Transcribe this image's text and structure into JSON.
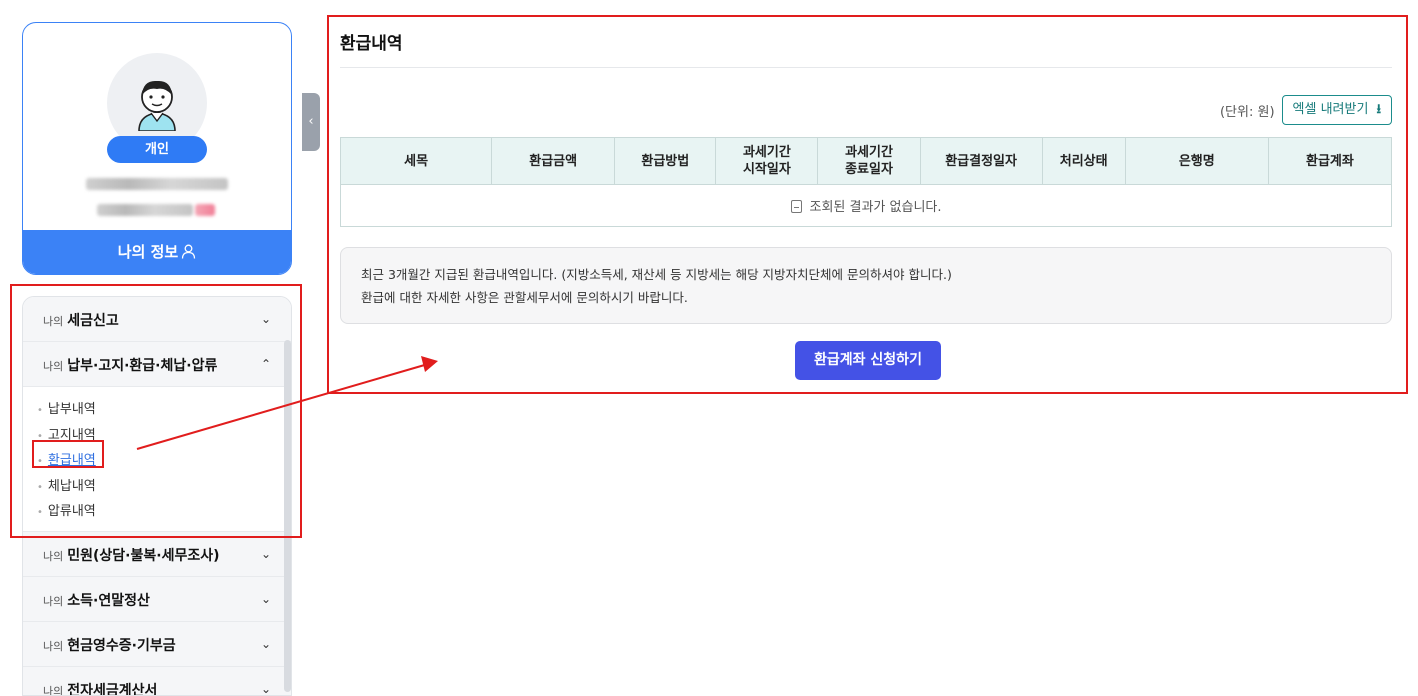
{
  "profile": {
    "type_badge": "개인",
    "my_info_label": "나의 정보"
  },
  "side_menu": {
    "prefix": "나의",
    "sections": [
      {
        "title": "세금신고",
        "expanded": false
      },
      {
        "title": "납부·고지·환급·체납·압류",
        "expanded": true,
        "items": [
          "납부내역",
          "고지내역",
          "환급내역",
          "체납내역",
          "압류내역"
        ],
        "active_item": "환급내역"
      },
      {
        "title": "민원(상담·불복·세무조사)",
        "expanded": false
      },
      {
        "title": "소득·연말정산",
        "expanded": false
      },
      {
        "title": "현금영수증·기부금",
        "expanded": false
      },
      {
        "title": "전자세금계산서",
        "expanded": false
      }
    ]
  },
  "main": {
    "title": "환급내역",
    "unit_text": "(단위: 원)",
    "excel_button": "엑셀 내려받기",
    "table": {
      "headers": [
        "세목",
        "환급금액",
        "환급방법",
        "과세기간\n시작일자",
        "과세기간\n종료일자",
        "환급결정일자",
        "처리상태",
        "은행명",
        "환급계좌"
      ],
      "empty_message": "조회된 결과가 없습니다."
    },
    "notice_lines": [
      "최근 3개월간 지급된 환급내역입니다. (지방소득세, 재산세 등 지방세는 해당 지방자치단체에 문의하셔야 합니다.)",
      "환급에 대한 자세한 사항은 관할세무서에 문의하시기 바랍니다."
    ],
    "apply_button": "환급계좌 신청하기"
  },
  "icons": {
    "chevron_down": "chevron-down-icon",
    "chevron_up": "chevron-up-icon",
    "download": "download-icon",
    "user": "user-icon",
    "document": "document-icon"
  },
  "colors": {
    "accent_blue": "#3b82f6",
    "apply_button": "#4452e6",
    "teal": "#167a7a",
    "highlight_red": "#e11d1d",
    "table_header_bg": "#e8f4f3"
  }
}
